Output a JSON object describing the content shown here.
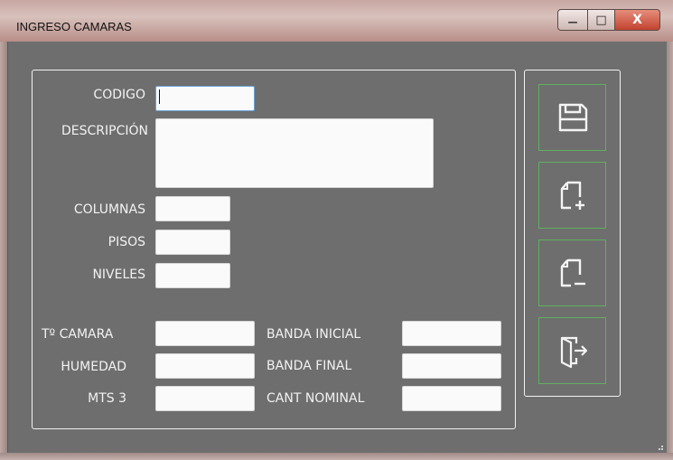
{
  "window": {
    "title": "INGRESO CAMARAS",
    "minimize_glyph": "—",
    "maximize_glyph": "□",
    "close_glyph": "X"
  },
  "form": {
    "codigo_label": "CODIGO",
    "codigo_value": "",
    "descripcion_label": "DESCRIPCIÓN",
    "descripcion_value": "",
    "columnas_label": "COLUMNAS",
    "pisos_label": "PISOS",
    "niveles_label": "NIVELES",
    "temp_label": "Tº CAMARA",
    "humedad_label": "HUMEDAD",
    "mts3_label": "MTS 3",
    "banda_inicial_label": "BANDA INICIAL",
    "banda_final_label": "BANDA FINAL",
    "cant_nominal_label": "CANT NOMINAL"
  },
  "actions": {
    "icons": [
      "save-icon",
      "new-document-icon",
      "remove-document-icon",
      "exit-door-icon"
    ]
  },
  "colors": {
    "background": "#6e6e6e",
    "text": "#f2f2f2",
    "button_border": "#5fb05f",
    "close_button": "#c2432f"
  }
}
